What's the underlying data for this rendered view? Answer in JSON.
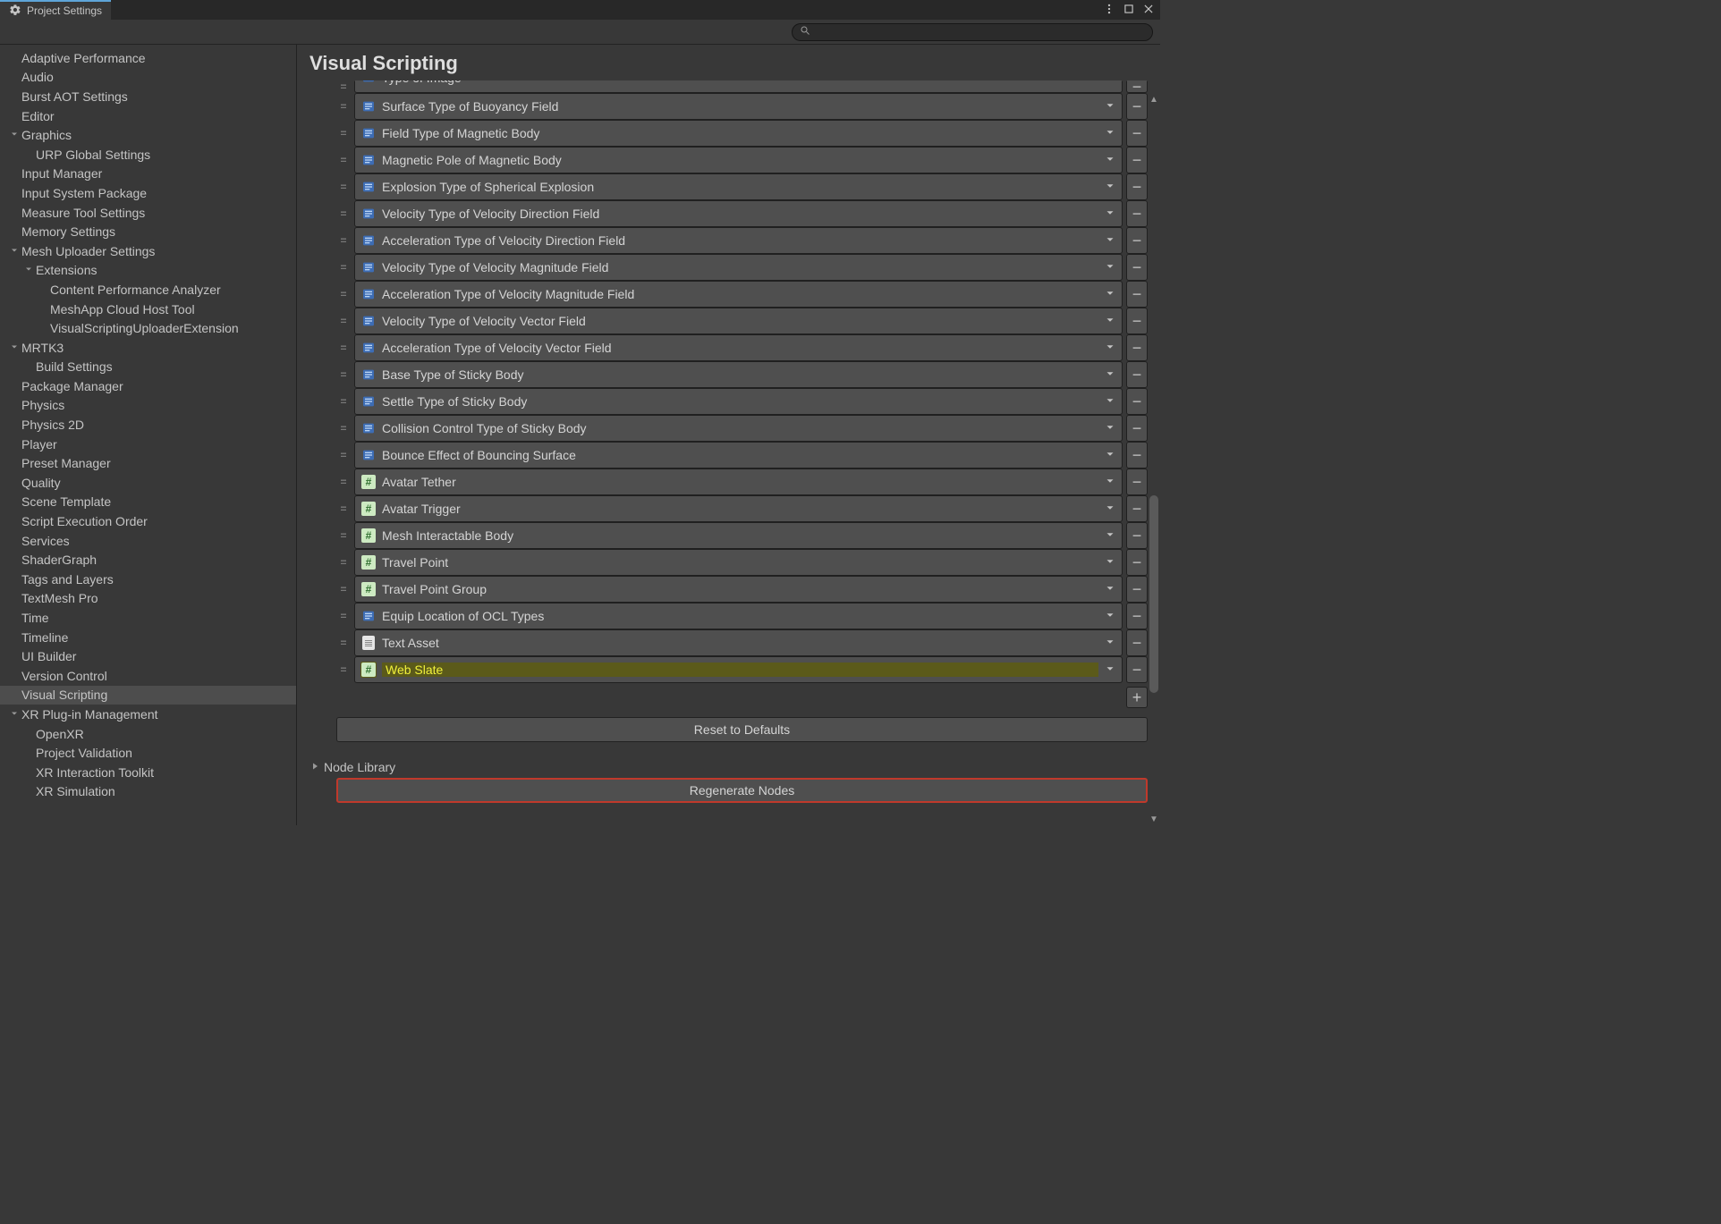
{
  "tab": {
    "title": "Project Settings"
  },
  "search": {
    "placeholder": ""
  },
  "sidebar": {
    "items": [
      {
        "label": "Adaptive Performance",
        "indent": 24
      },
      {
        "label": "Audio",
        "indent": 24
      },
      {
        "label": "Burst AOT Settings",
        "indent": 24
      },
      {
        "label": "Editor",
        "indent": 24
      },
      {
        "label": "Graphics",
        "indent": 24,
        "expandable": true
      },
      {
        "label": "URP Global Settings",
        "indent": 40
      },
      {
        "label": "Input Manager",
        "indent": 24
      },
      {
        "label": "Input System Package",
        "indent": 24
      },
      {
        "label": "Measure Tool Settings",
        "indent": 24
      },
      {
        "label": "Memory Settings",
        "indent": 24
      },
      {
        "label": "Mesh Uploader Settings",
        "indent": 24,
        "expandable": true
      },
      {
        "label": "Extensions",
        "indent": 40,
        "expandable": true
      },
      {
        "label": "Content Performance Analyzer",
        "indent": 56
      },
      {
        "label": "MeshApp Cloud Host Tool",
        "indent": 56
      },
      {
        "label": "VisualScriptingUploaderExtension",
        "indent": 56
      },
      {
        "label": "MRTK3",
        "indent": 24,
        "expandable": true
      },
      {
        "label": "Build Settings",
        "indent": 40
      },
      {
        "label": "Package Manager",
        "indent": 24
      },
      {
        "label": "Physics",
        "indent": 24
      },
      {
        "label": "Physics 2D",
        "indent": 24
      },
      {
        "label": "Player",
        "indent": 24
      },
      {
        "label": "Preset Manager",
        "indent": 24
      },
      {
        "label": "Quality",
        "indent": 24
      },
      {
        "label": "Scene Template",
        "indent": 24
      },
      {
        "label": "Script Execution Order",
        "indent": 24
      },
      {
        "label": "Services",
        "indent": 24
      },
      {
        "label": "ShaderGraph",
        "indent": 24
      },
      {
        "label": "Tags and Layers",
        "indent": 24
      },
      {
        "label": "TextMesh Pro",
        "indent": 24
      },
      {
        "label": "Time",
        "indent": 24
      },
      {
        "label": "Timeline",
        "indent": 24
      },
      {
        "label": "UI Builder",
        "indent": 24
      },
      {
        "label": "Version Control",
        "indent": 24
      },
      {
        "label": "Visual Scripting",
        "indent": 24,
        "selected": true
      },
      {
        "label": "XR Plug-in Management",
        "indent": 24,
        "expandable": true
      },
      {
        "label": "OpenXR",
        "indent": 40
      },
      {
        "label": "Project Validation",
        "indent": 40
      },
      {
        "label": "XR Interaction Toolkit",
        "indent": 40
      },
      {
        "label": "XR Simulation",
        "indent": 40
      }
    ]
  },
  "main": {
    "title": "Visual Scripting",
    "type_items": [
      {
        "label": "Type of Image",
        "icon": "enum",
        "clipped": true
      },
      {
        "label": "Surface Type of Buoyancy Field",
        "icon": "enum"
      },
      {
        "label": "Field Type of Magnetic Body",
        "icon": "enum"
      },
      {
        "label": "Magnetic Pole of Magnetic Body",
        "icon": "enum"
      },
      {
        "label": "Explosion Type of Spherical Explosion",
        "icon": "enum"
      },
      {
        "label": "Velocity Type of Velocity Direction Field",
        "icon": "enum"
      },
      {
        "label": "Acceleration Type of Velocity Direction Field",
        "icon": "enum"
      },
      {
        "label": "Velocity Type of Velocity Magnitude Field",
        "icon": "enum"
      },
      {
        "label": "Acceleration Type of Velocity Magnitude Field",
        "icon": "enum"
      },
      {
        "label": "Velocity Type of Velocity Vector Field",
        "icon": "enum"
      },
      {
        "label": "Acceleration Type of Velocity Vector Field",
        "icon": "enum"
      },
      {
        "label": "Base Type of Sticky Body",
        "icon": "enum"
      },
      {
        "label": "Settle Type of Sticky Body",
        "icon": "enum"
      },
      {
        "label": "Collision Control Type of Sticky Body",
        "icon": "enum"
      },
      {
        "label": "Bounce Effect of Bouncing Surface",
        "icon": "enum"
      },
      {
        "label": "Avatar Tether",
        "icon": "hash"
      },
      {
        "label": "Avatar Trigger",
        "icon": "hash"
      },
      {
        "label": "Mesh Interactable Body",
        "icon": "hash"
      },
      {
        "label": "Travel Point",
        "icon": "hash"
      },
      {
        "label": "Travel Point Group",
        "icon": "hash"
      },
      {
        "label": "Equip Location of OCL Types",
        "icon": "enum"
      },
      {
        "label": "Text Asset",
        "icon": "doc"
      },
      {
        "label": "Web Slate",
        "icon": "hash",
        "highlight": true
      }
    ],
    "reset_button": "Reset to Defaults",
    "node_library_header": "Node Library",
    "regenerate_button": "Regenerate Nodes"
  }
}
